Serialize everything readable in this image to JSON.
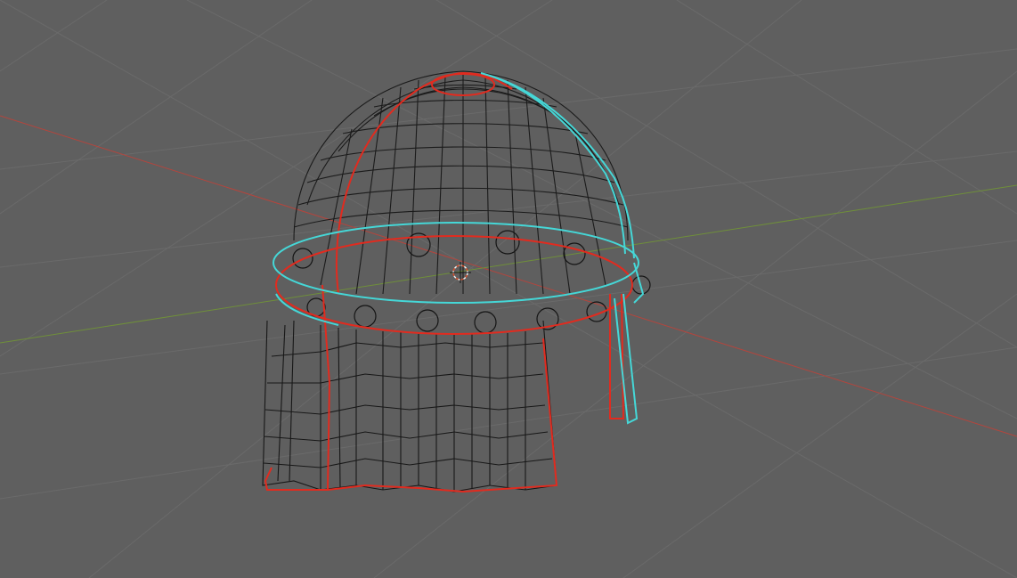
{
  "viewport": {
    "background_color": "#5f5f5f",
    "grid_color": "#6a6a6a",
    "x_axis_color": "#b4453d",
    "y_axis_color": "#6f8f3a"
  },
  "scene": {
    "object_wire_color": "#141414",
    "selected_outline_color": "#e12b1f",
    "active_outline_color": "#45d7d7",
    "cursor_color": "#f0f0f0",
    "cursor_accent": "#d8502b"
  }
}
